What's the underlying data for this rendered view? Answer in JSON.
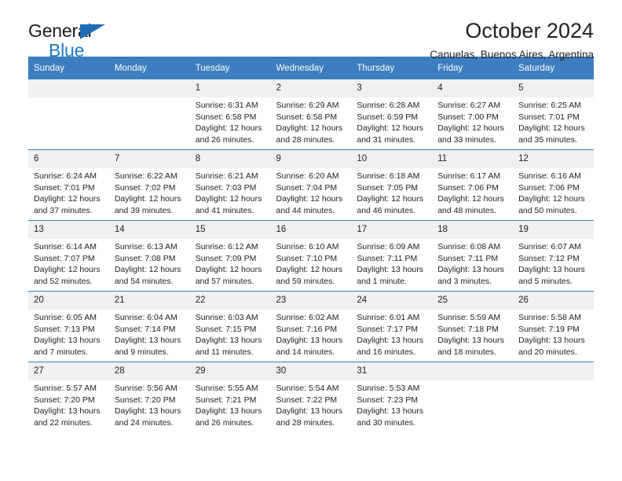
{
  "brand": {
    "name_part1": "General",
    "name_part2": "Blue",
    "triangle_icon": "triangle-icon",
    "accent_color": "#1f7ac4",
    "header_color": "#3c7ebf"
  },
  "header": {
    "title": "October 2024",
    "subtitle": "Canuelas, Buenos Aires, Argentina"
  },
  "weekdays": [
    "Sunday",
    "Monday",
    "Tuesday",
    "Wednesday",
    "Thursday",
    "Friday",
    "Saturday"
  ],
  "labels": {
    "sunrise_prefix": "Sunrise: ",
    "sunset_prefix": "Sunset: ",
    "daylight_prefix": "Daylight: "
  },
  "weeks": [
    [
      {
        "day": "",
        "sunrise": "",
        "sunset": "",
        "daylight": ""
      },
      {
        "day": "",
        "sunrise": "",
        "sunset": "",
        "daylight": ""
      },
      {
        "day": "1",
        "sunrise": "Sunrise: 6:31 AM",
        "sunset": "Sunset: 6:58 PM",
        "daylight": "Daylight: 12 hours and 26 minutes."
      },
      {
        "day": "2",
        "sunrise": "Sunrise: 6:29 AM",
        "sunset": "Sunset: 6:58 PM",
        "daylight": "Daylight: 12 hours and 28 minutes."
      },
      {
        "day": "3",
        "sunrise": "Sunrise: 6:28 AM",
        "sunset": "Sunset: 6:59 PM",
        "daylight": "Daylight: 12 hours and 31 minutes."
      },
      {
        "day": "4",
        "sunrise": "Sunrise: 6:27 AM",
        "sunset": "Sunset: 7:00 PM",
        "daylight": "Daylight: 12 hours and 33 minutes."
      },
      {
        "day": "5",
        "sunrise": "Sunrise: 6:25 AM",
        "sunset": "Sunset: 7:01 PM",
        "daylight": "Daylight: 12 hours and 35 minutes."
      }
    ],
    [
      {
        "day": "6",
        "sunrise": "Sunrise: 6:24 AM",
        "sunset": "Sunset: 7:01 PM",
        "daylight": "Daylight: 12 hours and 37 minutes."
      },
      {
        "day": "7",
        "sunrise": "Sunrise: 6:22 AM",
        "sunset": "Sunset: 7:02 PM",
        "daylight": "Daylight: 12 hours and 39 minutes."
      },
      {
        "day": "8",
        "sunrise": "Sunrise: 6:21 AM",
        "sunset": "Sunset: 7:03 PM",
        "daylight": "Daylight: 12 hours and 41 minutes."
      },
      {
        "day": "9",
        "sunrise": "Sunrise: 6:20 AM",
        "sunset": "Sunset: 7:04 PM",
        "daylight": "Daylight: 12 hours and 44 minutes."
      },
      {
        "day": "10",
        "sunrise": "Sunrise: 6:18 AM",
        "sunset": "Sunset: 7:05 PM",
        "daylight": "Daylight: 12 hours and 46 minutes."
      },
      {
        "day": "11",
        "sunrise": "Sunrise: 6:17 AM",
        "sunset": "Sunset: 7:06 PM",
        "daylight": "Daylight: 12 hours and 48 minutes."
      },
      {
        "day": "12",
        "sunrise": "Sunrise: 6:16 AM",
        "sunset": "Sunset: 7:06 PM",
        "daylight": "Daylight: 12 hours and 50 minutes."
      }
    ],
    [
      {
        "day": "13",
        "sunrise": "Sunrise: 6:14 AM",
        "sunset": "Sunset: 7:07 PM",
        "daylight": "Daylight: 12 hours and 52 minutes."
      },
      {
        "day": "14",
        "sunrise": "Sunrise: 6:13 AM",
        "sunset": "Sunset: 7:08 PM",
        "daylight": "Daylight: 12 hours and 54 minutes."
      },
      {
        "day": "15",
        "sunrise": "Sunrise: 6:12 AM",
        "sunset": "Sunset: 7:09 PM",
        "daylight": "Daylight: 12 hours and 57 minutes."
      },
      {
        "day": "16",
        "sunrise": "Sunrise: 6:10 AM",
        "sunset": "Sunset: 7:10 PM",
        "daylight": "Daylight: 12 hours and 59 minutes."
      },
      {
        "day": "17",
        "sunrise": "Sunrise: 6:09 AM",
        "sunset": "Sunset: 7:11 PM",
        "daylight": "Daylight: 13 hours and 1 minute."
      },
      {
        "day": "18",
        "sunrise": "Sunrise: 6:08 AM",
        "sunset": "Sunset: 7:11 PM",
        "daylight": "Daylight: 13 hours and 3 minutes."
      },
      {
        "day": "19",
        "sunrise": "Sunrise: 6:07 AM",
        "sunset": "Sunset: 7:12 PM",
        "daylight": "Daylight: 13 hours and 5 minutes."
      }
    ],
    [
      {
        "day": "20",
        "sunrise": "Sunrise: 6:05 AM",
        "sunset": "Sunset: 7:13 PM",
        "daylight": "Daylight: 13 hours and 7 minutes."
      },
      {
        "day": "21",
        "sunrise": "Sunrise: 6:04 AM",
        "sunset": "Sunset: 7:14 PM",
        "daylight": "Daylight: 13 hours and 9 minutes."
      },
      {
        "day": "22",
        "sunrise": "Sunrise: 6:03 AM",
        "sunset": "Sunset: 7:15 PM",
        "daylight": "Daylight: 13 hours and 11 minutes."
      },
      {
        "day": "23",
        "sunrise": "Sunrise: 6:02 AM",
        "sunset": "Sunset: 7:16 PM",
        "daylight": "Daylight: 13 hours and 14 minutes."
      },
      {
        "day": "24",
        "sunrise": "Sunrise: 6:01 AM",
        "sunset": "Sunset: 7:17 PM",
        "daylight": "Daylight: 13 hours and 16 minutes."
      },
      {
        "day": "25",
        "sunrise": "Sunrise: 5:59 AM",
        "sunset": "Sunset: 7:18 PM",
        "daylight": "Daylight: 13 hours and 18 minutes."
      },
      {
        "day": "26",
        "sunrise": "Sunrise: 5:58 AM",
        "sunset": "Sunset: 7:19 PM",
        "daylight": "Daylight: 13 hours and 20 minutes."
      }
    ],
    [
      {
        "day": "27",
        "sunrise": "Sunrise: 5:57 AM",
        "sunset": "Sunset: 7:20 PM",
        "daylight": "Daylight: 13 hours and 22 minutes."
      },
      {
        "day": "28",
        "sunrise": "Sunrise: 5:56 AM",
        "sunset": "Sunset: 7:20 PM",
        "daylight": "Daylight: 13 hours and 24 minutes."
      },
      {
        "day": "29",
        "sunrise": "Sunrise: 5:55 AM",
        "sunset": "Sunset: 7:21 PM",
        "daylight": "Daylight: 13 hours and 26 minutes."
      },
      {
        "day": "30",
        "sunrise": "Sunrise: 5:54 AM",
        "sunset": "Sunset: 7:22 PM",
        "daylight": "Daylight: 13 hours and 28 minutes."
      },
      {
        "day": "31",
        "sunrise": "Sunrise: 5:53 AM",
        "sunset": "Sunset: 7:23 PM",
        "daylight": "Daylight: 13 hours and 30 minutes."
      },
      {
        "day": "",
        "sunrise": "",
        "sunset": "",
        "daylight": ""
      },
      {
        "day": "",
        "sunrise": "",
        "sunset": "",
        "daylight": ""
      }
    ]
  ]
}
